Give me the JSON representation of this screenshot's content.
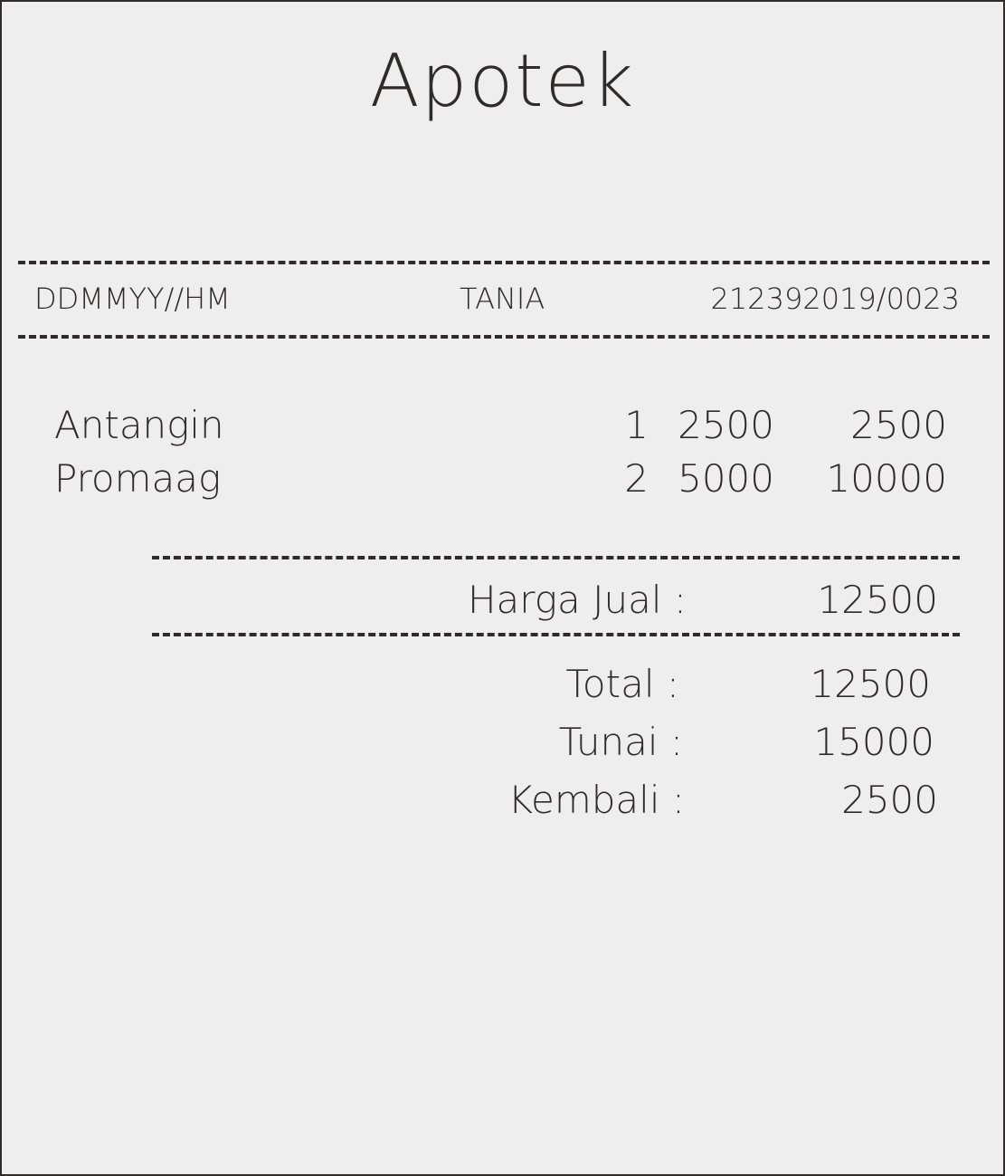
{
  "store_name": "Apotek",
  "header": {
    "date_code": "DDMMYY//HM",
    "cashier": "TANIA",
    "transaction_number": "212392019/0023"
  },
  "items": [
    {
      "name": "Antangin",
      "qty": "1",
      "price": "2500",
      "subtotal": "2500"
    },
    {
      "name": "Promaag",
      "qty": "2",
      "price": "5000",
      "subtotal": "10000"
    }
  ],
  "summary": {
    "harga_jual_label": "Harga Jual :",
    "harga_jual_value": "12500",
    "total_label": "Total :",
    "total_value": "12500",
    "tunai_label": "Tunai :",
    "tunai_value": "15000",
    "kembali_label": "Kembali :",
    "kembali_value": "2500"
  }
}
